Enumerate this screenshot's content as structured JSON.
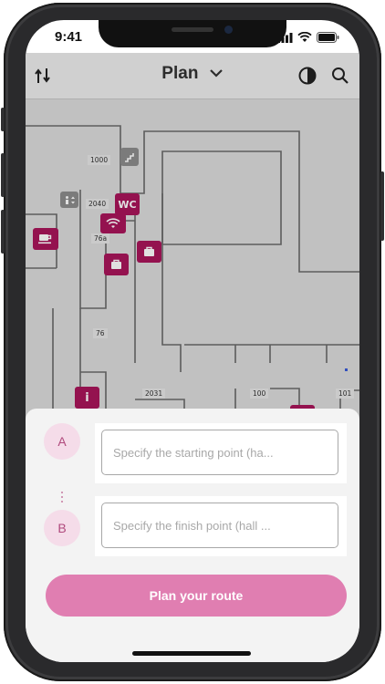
{
  "status_bar": {
    "time": "9:41"
  },
  "header": {
    "title": "Plan"
  },
  "map": {
    "room_labels": [
      "1000",
      "2040",
      "76a",
      "76",
      "2031",
      "100",
      "101"
    ],
    "poi_wc_label": "WC",
    "poi_info_label": "i"
  },
  "route": {
    "start_marker": "A",
    "finish_marker": "B",
    "start_placeholder": "Specify the starting point (ha...",
    "finish_placeholder": "Specify the finish point (hall ...",
    "plan_button": "Plan your route"
  },
  "colors": {
    "accent": "#a9155a",
    "button": "#e07eb1",
    "marker_bg": "#f5dce9"
  }
}
